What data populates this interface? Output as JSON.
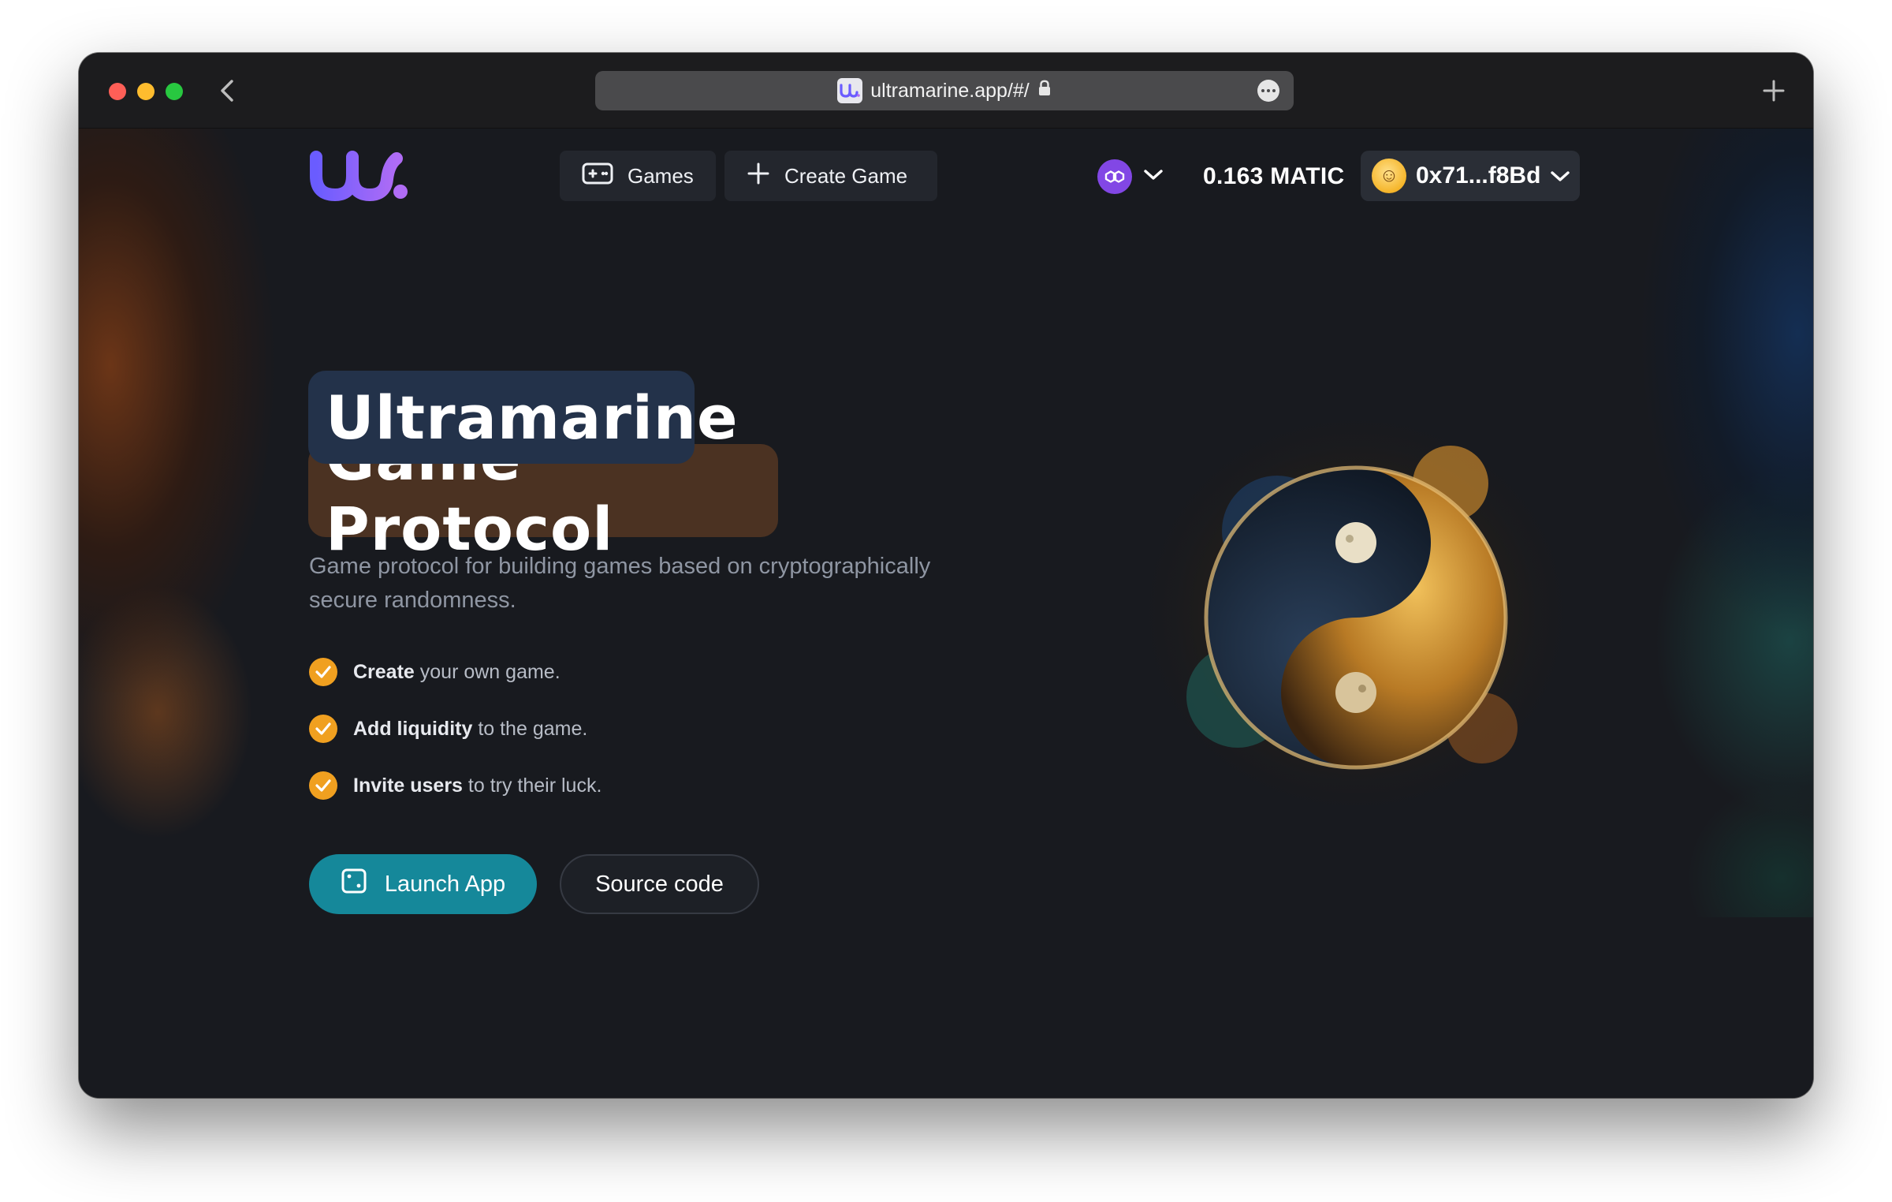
{
  "browser": {
    "url": "ultramarine.app/#/",
    "favicon_text": "UW."
  },
  "nav": {
    "logo_icon": "ultramarine-logo-icon",
    "games_label": "Games",
    "create_game_label": "Create Game",
    "network_icon": "polygon-icon",
    "balance": "0.163 MATIC",
    "account": "0x71...f8Bd",
    "avatar_icon": "emoji-avatar-icon"
  },
  "hero": {
    "title_line1": "Ultramarine",
    "title_line2": "Game Protocol",
    "subtitle": "Game protocol for building games based on cryptographically secure randomness.",
    "features": [
      {
        "bold": "Create",
        "rest": " your own game."
      },
      {
        "bold": "Add liquidity",
        "rest": " to the game."
      },
      {
        "bold": "Invite users",
        "rest": " to try their luck."
      }
    ],
    "launch_label": "Launch App",
    "source_label": "Source code",
    "art": "yin-yang-forest-illustration"
  },
  "colors": {
    "background": "#181a1f",
    "accent_teal": "#15889a",
    "accent_orange": "#f0a020",
    "title_bg_blue": "#23324a",
    "title_bg_brown": "#4b3222",
    "polygon_purple": "#8247e5",
    "logo_gradient": [
      "#6a5cff",
      "#b06cf5"
    ]
  }
}
